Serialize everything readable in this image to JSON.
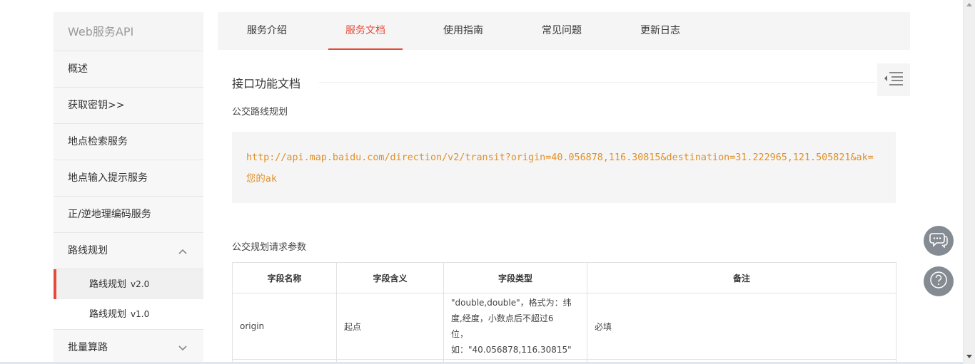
{
  "sidebar": {
    "title": "Web服务API",
    "items": [
      {
        "label": "概述"
      },
      {
        "label": "获取密钥>>"
      },
      {
        "label": "地点检索服务"
      },
      {
        "label": "地点输入提示服务"
      },
      {
        "label": "正/逆地理编码服务"
      },
      {
        "label": "路线规划",
        "icon": "chevron-up-icon"
      }
    ],
    "sub_items": [
      {
        "label": "路线规划",
        "version": "v2.0",
        "active": true
      },
      {
        "label": "路线规划",
        "version": "v1.0",
        "active": false
      }
    ],
    "tail_item": {
      "label": "批量算路",
      "icon": "chevron-down-icon"
    }
  },
  "tabs": [
    {
      "label": "服务介绍",
      "active": false
    },
    {
      "label": "服务文档",
      "active": true
    },
    {
      "label": "使用指南",
      "active": false
    },
    {
      "label": "常见问题",
      "active": false
    },
    {
      "label": "更新日志",
      "active": false
    }
  ],
  "main": {
    "doc_title": "接口功能文档",
    "sub_heading": "公交路线规划",
    "code_url": "http://api.map.baidu.com/direction/v2/transit?origin=40.056878,116.30815&destination=31.222965,121.505821&ak=您的ak",
    "param_heading": "公交规划请求参数",
    "table": {
      "headers": [
        "字段名称",
        "字段含义",
        "字段类型",
        "备注"
      ],
      "rows": [
        {
          "name": "origin",
          "meaning": "起点",
          "type_lines": [
            "\"double,double\"，格式为：纬",
            "度,经度，小数点后不超过6",
            "位，",
            "如：\"40.056878,116.30815\""
          ],
          "note": "必填"
        }
      ]
    }
  },
  "floating": {
    "chat_icon": "chat-bubble-icon",
    "help_icon": "question-mark-icon",
    "toc_icon": "toc-list-icon"
  },
  "colors": {
    "accent": "#e64a3b",
    "code": "#e0902a",
    "float_btn": "#858b93"
  }
}
